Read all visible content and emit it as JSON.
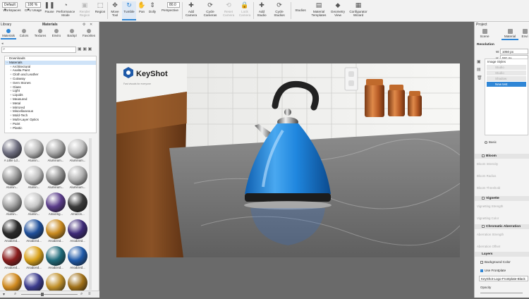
{
  "toolbar": {
    "workspace_select": "Default",
    "zoom_select": "100 %",
    "samples_value": "80.0",
    "buttons": [
      {
        "label": "Workspaces",
        "icon": "grid-icon"
      },
      {
        "label": "CPU Usage",
        "icon": "cpu-icon"
      },
      {
        "label": "Pause",
        "icon": "pause-icon"
      },
      {
        "label": "Performance Mode",
        "icon": "gauge-icon"
      },
      {
        "label": "Render Region",
        "icon": "region-icon"
      },
      {
        "label": "Region",
        "icon": "crop-icon"
      },
      {
        "label": "Move Tool",
        "icon": "move-icon"
      },
      {
        "label": "Tumble",
        "icon": "tumble-icon"
      },
      {
        "label": "Pan",
        "icon": "pan-icon"
      },
      {
        "label": "Dolly",
        "icon": "dolly-icon"
      },
      {
        "label": "Perspective",
        "icon": "perspective-icon"
      },
      {
        "label": "Add Camera",
        "icon": "add-camera-icon"
      },
      {
        "label": "Cycle Cameras",
        "icon": "cycle-cameras-icon"
      },
      {
        "label": "Reset Camera",
        "icon": "reset-camera-icon"
      },
      {
        "label": "Lock Camera",
        "icon": "lock-camera-icon"
      },
      {
        "label": "Add Studio",
        "icon": "add-studio-icon"
      },
      {
        "label": "Cycle Studios",
        "icon": "cycle-studios-icon"
      },
      {
        "label": "Studios",
        "icon": "studios-icon"
      },
      {
        "label": "Material Templates",
        "icon": "material-templates-icon"
      },
      {
        "label": "Geometry View",
        "icon": "geometry-view-icon"
      },
      {
        "label": "Configurator Wizard",
        "icon": "configurator-icon"
      }
    ]
  },
  "library": {
    "panel_label": "Library",
    "title": "Materials",
    "tabs": [
      "Materials",
      "Colors",
      "Textures",
      "Enviro",
      "Backpl",
      "Favorites"
    ],
    "tree": [
      {
        "label": "Downloads",
        "depth": 0,
        "selected": false
      },
      {
        "label": "Materials",
        "depth": 0,
        "selected": true
      },
      {
        "label": "Architectural",
        "depth": 1,
        "selected": false
      },
      {
        "label": "Axalta Paint",
        "depth": 1,
        "selected": false
      },
      {
        "label": "Cloth and Leather",
        "depth": 1,
        "selected": false
      },
      {
        "label": "Cutaway",
        "depth": 1,
        "selected": false
      },
      {
        "label": "Gem Stones",
        "depth": 1,
        "selected": false
      },
      {
        "label": "Glass",
        "depth": 1,
        "selected": false
      },
      {
        "label": "Light",
        "depth": 1,
        "selected": false
      },
      {
        "label": "Liquids",
        "depth": 1,
        "selected": false
      },
      {
        "label": "Measured",
        "depth": 1,
        "selected": false
      },
      {
        "label": "Metal",
        "depth": 1,
        "selected": false
      },
      {
        "label": "Mirrored",
        "depth": 1,
        "selected": false
      },
      {
        "label": "Miscellaneous",
        "depth": 1,
        "selected": false
      },
      {
        "label": "Mold-Tech",
        "depth": 1,
        "selected": false
      },
      {
        "label": "Multi-Layer Optics",
        "depth": 1,
        "selected": false
      },
      {
        "label": "Paint",
        "depth": 1,
        "selected": false
      },
      {
        "label": "Plastic",
        "depth": 1,
        "selected": false
      }
    ],
    "thumbnails": [
      {
        "label": "A Little Ld...",
        "color": "#6f6f80"
      },
      {
        "label": "Alumin...",
        "color": "#b7b7b7"
      },
      {
        "label": "Aluminum...",
        "color": "#a8a8a8"
      },
      {
        "label": "Aluminum...",
        "color": "#c0c0c0"
      },
      {
        "label": "Alumin...",
        "color": "#9a9a9a"
      },
      {
        "label": "Alumin...",
        "color": "#bdbdbd"
      },
      {
        "label": "Aluminum...",
        "color": "#8f8f8f"
      },
      {
        "label": "Aluminum...",
        "color": "#b0b0b0"
      },
      {
        "label": "Alumin...",
        "color": "#a0a0a0"
      },
      {
        "label": "Alumin...",
        "color": "#c7c7c7"
      },
      {
        "label": "Amazing...",
        "color": "#5a3c8a"
      },
      {
        "label": "Amazon...",
        "color": "#3a3a3a"
      },
      {
        "label": "Anodized...",
        "color": "#2a2a2a"
      },
      {
        "label": "Anodized...",
        "color": "#1f4f9a"
      },
      {
        "label": "Anodized...",
        "color": "#c98a1f"
      },
      {
        "label": "Anodized...",
        "color": "#3e2a78"
      },
      {
        "label": "Anodized...",
        "color": "#8a1e1e"
      },
      {
        "label": "Anodized...",
        "color": "#d9a21c"
      },
      {
        "label": "Anodized...",
        "color": "#1f6a7a"
      },
      {
        "label": "Anodized...",
        "color": "#205aa8"
      },
      {
        "label": "",
        "color": "#d08a20"
      },
      {
        "label": "",
        "color": "#3b3b8c"
      },
      {
        "label": "",
        "color": "#c0902a"
      },
      {
        "label": "",
        "color": "#a07018"
      }
    ]
  },
  "viewport": {
    "logo_text": "KeyShot",
    "logo_tagline": "Fast visuals for everyone"
  },
  "project": {
    "panel_label": "Project",
    "tabs": [
      "Scene",
      "Material",
      "Envi"
    ],
    "resolution_label": "Resolution",
    "width_label": "W:",
    "width_value": "1050 px",
    "height_label": "H:",
    "height_value": "591 px",
    "image_styles_label": "Image Styles",
    "styles": [
      {
        "label": "Studio",
        "selected": false
      },
      {
        "label": "Studio",
        "selected": false
      },
      {
        "label": "Shadow",
        "selected": false
      },
      {
        "label": "New test",
        "selected": true
      }
    ],
    "basic_label": "Basic",
    "bloom_label": "Bloom",
    "bloom_fields": [
      "Bloom Intensity",
      "Bloom Radius",
      "Bloom Threshold"
    ],
    "vignette_label": "Vignette",
    "vignette_fields": [
      "Vignetting Strength",
      "Vignetting Color"
    ],
    "chromatic_label": "Chromatic Aberration",
    "chromatic_fields": [
      "Aberration Strength",
      "Aberration Offset"
    ],
    "layers_label": "Layers",
    "background_color_label": "Background Color",
    "use_frontplate_label": "Use Frontplate",
    "frontplate_file": "KeyShot-Logo-Frontplate-Black",
    "opacity_label": "Opacity"
  },
  "colors": {
    "accent": "#2f86d6",
    "kettle_body": "#1f86de",
    "viewport_frame": "#6a6a6a"
  }
}
